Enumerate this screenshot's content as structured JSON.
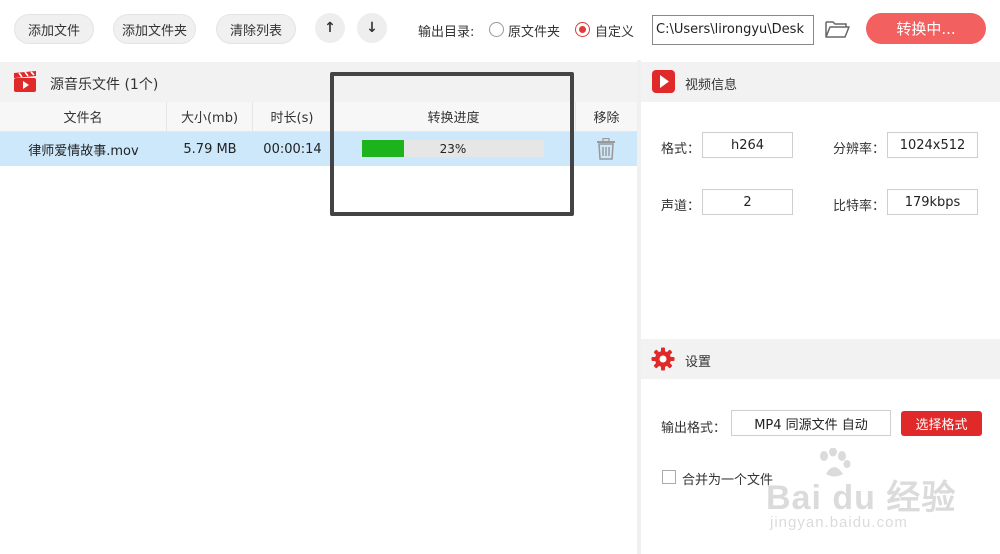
{
  "toolbar": {
    "add_file": "添加文件",
    "add_folder": "添加文件夹",
    "clear_list": "清除列表",
    "up_icon": "arrow-up-icon",
    "down_icon": "arrow-down-icon",
    "output_dir_label": "输出目录:",
    "option_original": "原文件夹",
    "option_custom": "自定义",
    "selected_option": "自定义",
    "output_path": "C:\\Users\\lirongyu\\Desk",
    "folder_icon": "folder-open-icon",
    "convert_label": "转换中..."
  },
  "source": {
    "title": "源音乐文件 (1个)",
    "columns": [
      "文件名",
      "大小(mb)",
      "时长(s)",
      "转换进度",
      "移除"
    ],
    "rows": [
      {
        "name": "律师爱情故事.mov",
        "size": "5.79 MB",
        "duration": "00:00:14",
        "progress_text": "23%",
        "progress": 0.23
      }
    ]
  },
  "video_info": {
    "title": "视频信息",
    "format_label": "格式：",
    "format_value": "h264",
    "resolution_label": "分辨率：",
    "resolution_value": "1024x512",
    "channels_label": "声道：",
    "channels_value": "2",
    "bitrate_label": "比特率：",
    "bitrate_value": "179kbps"
  },
  "settings": {
    "title": "设置",
    "output_format_label": "输出格式：",
    "output_format_value": "MP4 同源文件 自动",
    "select_format_label": "选择格式",
    "merge_label": "合并为一个文件",
    "merge_checked": false
  },
  "watermark": {
    "logo_text": "Bai du 经验",
    "url_text": "jingyan.baidu.com"
  },
  "colors": {
    "accent_red": "#e02a2a",
    "convert_button": "#f26060",
    "selected_row": "#cde8fa",
    "progress_green": "#1db31d"
  }
}
